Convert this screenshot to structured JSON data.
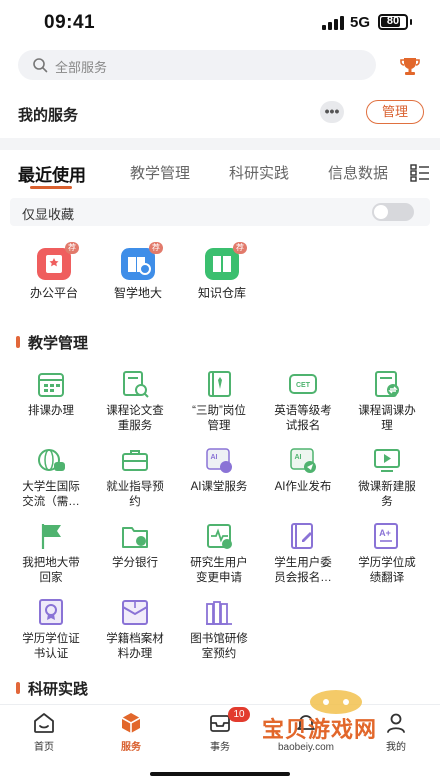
{
  "status_bar": {
    "time": "09:41",
    "network": "5G",
    "battery": "80",
    "battery_level": 0.8
  },
  "search": {
    "placeholder": "全部服务"
  },
  "my_services": {
    "title": "我的服务",
    "more": "•••",
    "manage": "管理"
  },
  "tabs": [
    {
      "label": "最近使用",
      "active": true
    },
    {
      "label": "教学管理",
      "active": false
    },
    {
      "label": "科研实践",
      "active": false
    },
    {
      "label": "信息数据",
      "active": false
    }
  ],
  "favorites": {
    "label": "仅显收藏",
    "on": false
  },
  "recent": [
    {
      "label": "办公平台",
      "badge": "荐",
      "color": "#ef5e5e"
    },
    {
      "label": "智学地大",
      "badge": "荐",
      "color": "#3f8ee8"
    },
    {
      "label": "知识仓库",
      "badge": "荐",
      "color": "#3bbf6f"
    }
  ],
  "sections": {
    "teaching": "教学管理",
    "research": "科研实践"
  },
  "teaching_items": [
    {
      "line1": "排课办理",
      "line2": "",
      "icon": "calendar-icon"
    },
    {
      "line1": "课程论文查",
      "line2": "重服务",
      "icon": "document-search-icon"
    },
    {
      "line1": "“三助”岗位",
      "line2": "管理",
      "icon": "tie-book-icon"
    },
    {
      "line1": "英语等级考",
      "line2": "试报名",
      "icon": "cet-scroll-icon"
    },
    {
      "line1": "课程调课办",
      "line2": "理",
      "icon": "document-swap-icon"
    },
    {
      "line1": "大学生国际",
      "line2": "交流（需…",
      "icon": "globe-chat-icon"
    },
    {
      "line1": "就业指导预",
      "line2": "约",
      "icon": "briefcase-icon"
    },
    {
      "line1": "AI课堂服务",
      "line2": "",
      "icon": "ai-chat-icon"
    },
    {
      "line1": "AI作业发布",
      "line2": "",
      "icon": "ai-send-icon"
    },
    {
      "line1": "微课新建服",
      "line2": "务",
      "icon": "video-icon"
    },
    {
      "line1": "我把地大带",
      "line2": "回家",
      "icon": "flag-icon"
    },
    {
      "line1": "学分银行",
      "line2": "",
      "icon": "folder-icon"
    },
    {
      "line1": "研究生用户",
      "line2": "变更申请",
      "icon": "pulse-board-icon"
    },
    {
      "line1": "学生用户委",
      "line2": "员会报名…",
      "icon": "edit-book-icon"
    },
    {
      "line1": "学历学位成",
      "line2": "绩翻译",
      "icon": "translate-icon"
    },
    {
      "line1": "学历学位证",
      "line2": "书认证",
      "icon": "certificate-icon"
    },
    {
      "line1": "学籍档案材",
      "line2": "料办理",
      "icon": "archive-icon"
    },
    {
      "line1": "图书馆研修",
      "line2": "室预约",
      "icon": "books-icon"
    }
  ],
  "bottom_nav": [
    {
      "label": "首页",
      "icon": "home-icon",
      "active": false
    },
    {
      "label": "服务",
      "icon": "cube-icon",
      "active": true
    },
    {
      "label": "事务",
      "icon": "inbox-icon",
      "active": false,
      "badge": "10"
    },
    {
      "label": "",
      "icon": "bell-icon",
      "active": false
    },
    {
      "label": "我的",
      "icon": "user-icon",
      "active": false
    }
  ],
  "watermark": {
    "title": "宝贝游戏网",
    "url": "baobeiy.com"
  },
  "colors": {
    "accent": "#d9602f",
    "icon_green": "#4fb36f",
    "icon_purple": "#8a73d6"
  }
}
